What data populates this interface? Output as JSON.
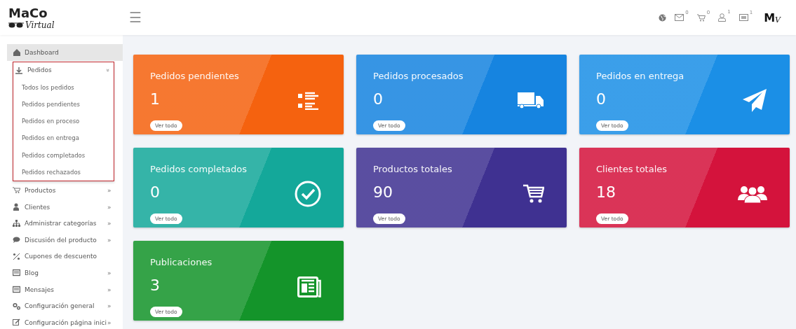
{
  "header": {
    "logo": {
      "main": "MaCo",
      "script": "Virtual"
    },
    "menu_glyph": "☰",
    "notifications": [
      {
        "kind": "globe"
      },
      {
        "kind": "mail",
        "count": "0"
      },
      {
        "kind": "cart",
        "count": "0"
      },
      {
        "kind": "user",
        "count": "1"
      },
      {
        "kind": "card",
        "count": "1"
      }
    ],
    "avatar": {
      "letter": "M",
      "script": "V"
    }
  },
  "sidebar": {
    "items": [
      {
        "label": "Dashboard",
        "selected": true
      },
      {
        "label": "Pedidos",
        "selected": false,
        "expanded": true,
        "arrow": "»",
        "children": [
          {
            "label": "Todos los pedidos"
          },
          {
            "label": "Pedidos pendientes"
          },
          {
            "label": "Pedidos en proceso"
          },
          {
            "label": "Pedidos en entrega"
          },
          {
            "label": "Pedidos completados"
          },
          {
            "label": "Pedidos rechazados"
          }
        ]
      },
      {
        "label": "Productos",
        "selected": false,
        "arrow": "»"
      },
      {
        "label": "Clientes",
        "selected": false,
        "arrow": "»"
      },
      {
        "label": "Administrar categorías",
        "selected": false,
        "arrow": "»"
      },
      {
        "label": "Discusión del producto",
        "selected": false,
        "arrow": "»"
      },
      {
        "label": "Cupones de descuento",
        "selected": false
      },
      {
        "label": "Blog",
        "selected": false,
        "arrow": "»"
      },
      {
        "label": "Mensajes",
        "selected": false,
        "arrow": "»"
      },
      {
        "label": "Configuración general",
        "selected": false,
        "arrow": "»"
      },
      {
        "label": "Configuración página inici",
        "selected": false,
        "arrow": "»"
      }
    ]
  },
  "cards": [
    {
      "title": "Pedidos pendientes",
      "value": "1",
      "button": "Ver todo",
      "color": "#f5620f",
      "kind": "list"
    },
    {
      "title": "Pedidos procesados",
      "value": "0",
      "button": "Ver todo",
      "color": "#1684e0",
      "kind": "truck"
    },
    {
      "title": "Pedidos en entrega",
      "value": "0",
      "button": "Ver todo",
      "color": "#1b8fe6",
      "kind": "plane"
    },
    {
      "title": "Pedidos completados",
      "value": "0",
      "button": "Ver todo",
      "color": "#14a89a",
      "kind": "check"
    },
    {
      "title": "Productos totales",
      "value": "90",
      "button": "Ver todo",
      "color": "#3f3191",
      "kind": "cart"
    },
    {
      "title": "Clientes totales",
      "value": "18",
      "button": "Ver todo",
      "color": "#d4133c",
      "kind": "users"
    },
    {
      "title": "Publicaciones",
      "value": "3",
      "button": "Ver todo",
      "color": "#14942a",
      "kind": "news"
    }
  ]
}
